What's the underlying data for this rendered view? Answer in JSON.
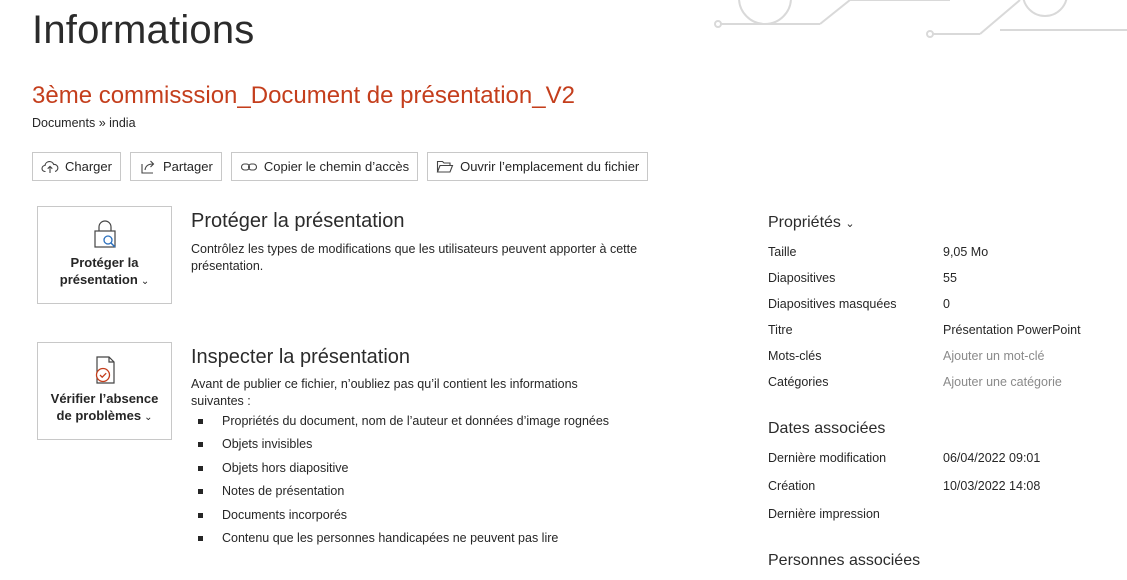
{
  "page": {
    "title": "Informations",
    "doc_title": "3ème commisssion_Document de présentation_V2",
    "breadcrumb": "Documents » india"
  },
  "toolbar": {
    "upload_label": "Charger",
    "share_label": "Partager",
    "copy_path_label": "Copier le chemin d’accès",
    "open_location_label": "Ouvrir l’emplacement du fichier"
  },
  "protect": {
    "tile_line1": "Protéger la",
    "tile_line2": "présentation",
    "title": "Protéger la présentation",
    "description": "Contrôlez les types de modifications que les utilisateurs peuvent apporter à cette présentation."
  },
  "inspect": {
    "tile_line1": "Vérifier l’absence",
    "tile_line2": "de problèmes",
    "title": "Inspecter la présentation",
    "description": "Avant de publier ce fichier, n’oubliez pas qu’il contient les informations suivantes :",
    "items": [
      "Propriétés du document, nom de l’auteur et données d’image rognées",
      "Objets invisibles",
      "Objets hors diapositive",
      "Notes de présentation",
      "Documents incorporés",
      "Contenu que les personnes handicapées ne peuvent pas lire"
    ]
  },
  "properties": {
    "heading": "Propriétés",
    "rows": [
      {
        "key": "Taille",
        "value": "9,05 Mo"
      },
      {
        "key": "Diapositives",
        "value": "55"
      },
      {
        "key": "Diapositives masquées",
        "value": "0"
      },
      {
        "key": "Titre",
        "value": "Présentation PowerPoint"
      },
      {
        "key": "Mots-clés",
        "value": "Ajouter un mot-clé"
      },
      {
        "key": "Catégories",
        "value": "Ajouter une catégorie"
      }
    ]
  },
  "dates": {
    "heading": "Dates associées",
    "rows": [
      {
        "key": "Dernière modification",
        "value": "06/04/2022 09:01"
      },
      {
        "key": "Création",
        "value": "10/03/2022 14:08"
      },
      {
        "key": "Dernière impression",
        "value": ""
      }
    ]
  },
  "people": {
    "heading": "Personnes associées"
  },
  "icons": {
    "upload": "cloud-upload-icon",
    "share": "share-icon",
    "link": "link-icon",
    "folder": "folder-open-icon",
    "protect": "lock-search-icon",
    "inspect": "document-check-icon",
    "chevron": "chevron-down-icon"
  },
  "colors": {
    "accent": "#c43e1c",
    "border": "#c8c8c8",
    "muted": "#8a8a8a"
  }
}
